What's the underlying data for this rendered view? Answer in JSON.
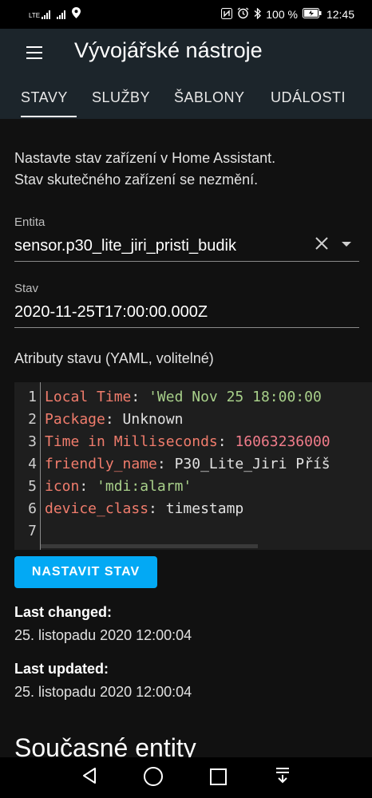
{
  "status_bar": {
    "left_icons": [
      "lte-signal-icon",
      "signal-icon",
      "location-icon"
    ],
    "network": "LTE",
    "right_icons": [
      "nfc-icon",
      "alarm-icon",
      "bluetooth-icon",
      "battery-icon"
    ],
    "battery": "100 %",
    "time": "12:45"
  },
  "app_bar": {
    "title": "Vývojářské nástroje",
    "menu_icon": "menu-icon"
  },
  "tabs": [
    {
      "label": "STAVY",
      "active": true
    },
    {
      "label": "SLUŽBY"
    },
    {
      "label": "ŠABLONY"
    },
    {
      "label": "UDÁLOSTI"
    }
  ],
  "description": {
    "line1": "Nastavte stav zařízení v Home Assistant.",
    "line2": "Stav skutečného zařízení se nezmění."
  },
  "entity": {
    "label": "Entita",
    "value": "sensor.p30_lite_jiri_pristi_budik"
  },
  "state": {
    "label": "Stav",
    "value": "2020-11-25T17:00:00.000Z"
  },
  "attributes": {
    "label": "Atributy stavu (YAML, volitelné)",
    "lines": [
      {
        "num": "1",
        "key": "Local Time",
        "sep": ": ",
        "val": "'Wed Nov 25 18:00:00",
        "type": "s"
      },
      {
        "num": "2",
        "key": "Package",
        "sep": ": ",
        "val": "Unknown",
        "type": "v"
      },
      {
        "num": "3",
        "key": "Time in Milliseconds",
        "sep": ": ",
        "val": "16063236000",
        "type": "n"
      },
      {
        "num": "4",
        "key": "friendly_name",
        "sep": ": ",
        "val": "P30_Lite_Jiri Příš",
        "type": "v"
      },
      {
        "num": "5",
        "key": "icon",
        "sep": ": ",
        "val": "'mdi:alarm'",
        "type": "s"
      },
      {
        "num": "6",
        "key": "device_class",
        "sep": ": ",
        "val": "timestamp",
        "type": "v"
      },
      {
        "num": "7",
        "key": "",
        "sep": "",
        "val": "",
        "type": "v"
      }
    ]
  },
  "set_button": "NASTAVIT STAV",
  "last_changed": {
    "label": "Last changed:",
    "value": "25. listopadu 2020 12:00:04"
  },
  "last_updated": {
    "label": "Last updated:",
    "value": "25. listopadu 2020 12:00:04"
  },
  "section_title": "Současné entity",
  "nav_bar": {
    "icons": [
      "back-icon",
      "home-icon",
      "recents-icon",
      "notification-pull-icon"
    ]
  }
}
